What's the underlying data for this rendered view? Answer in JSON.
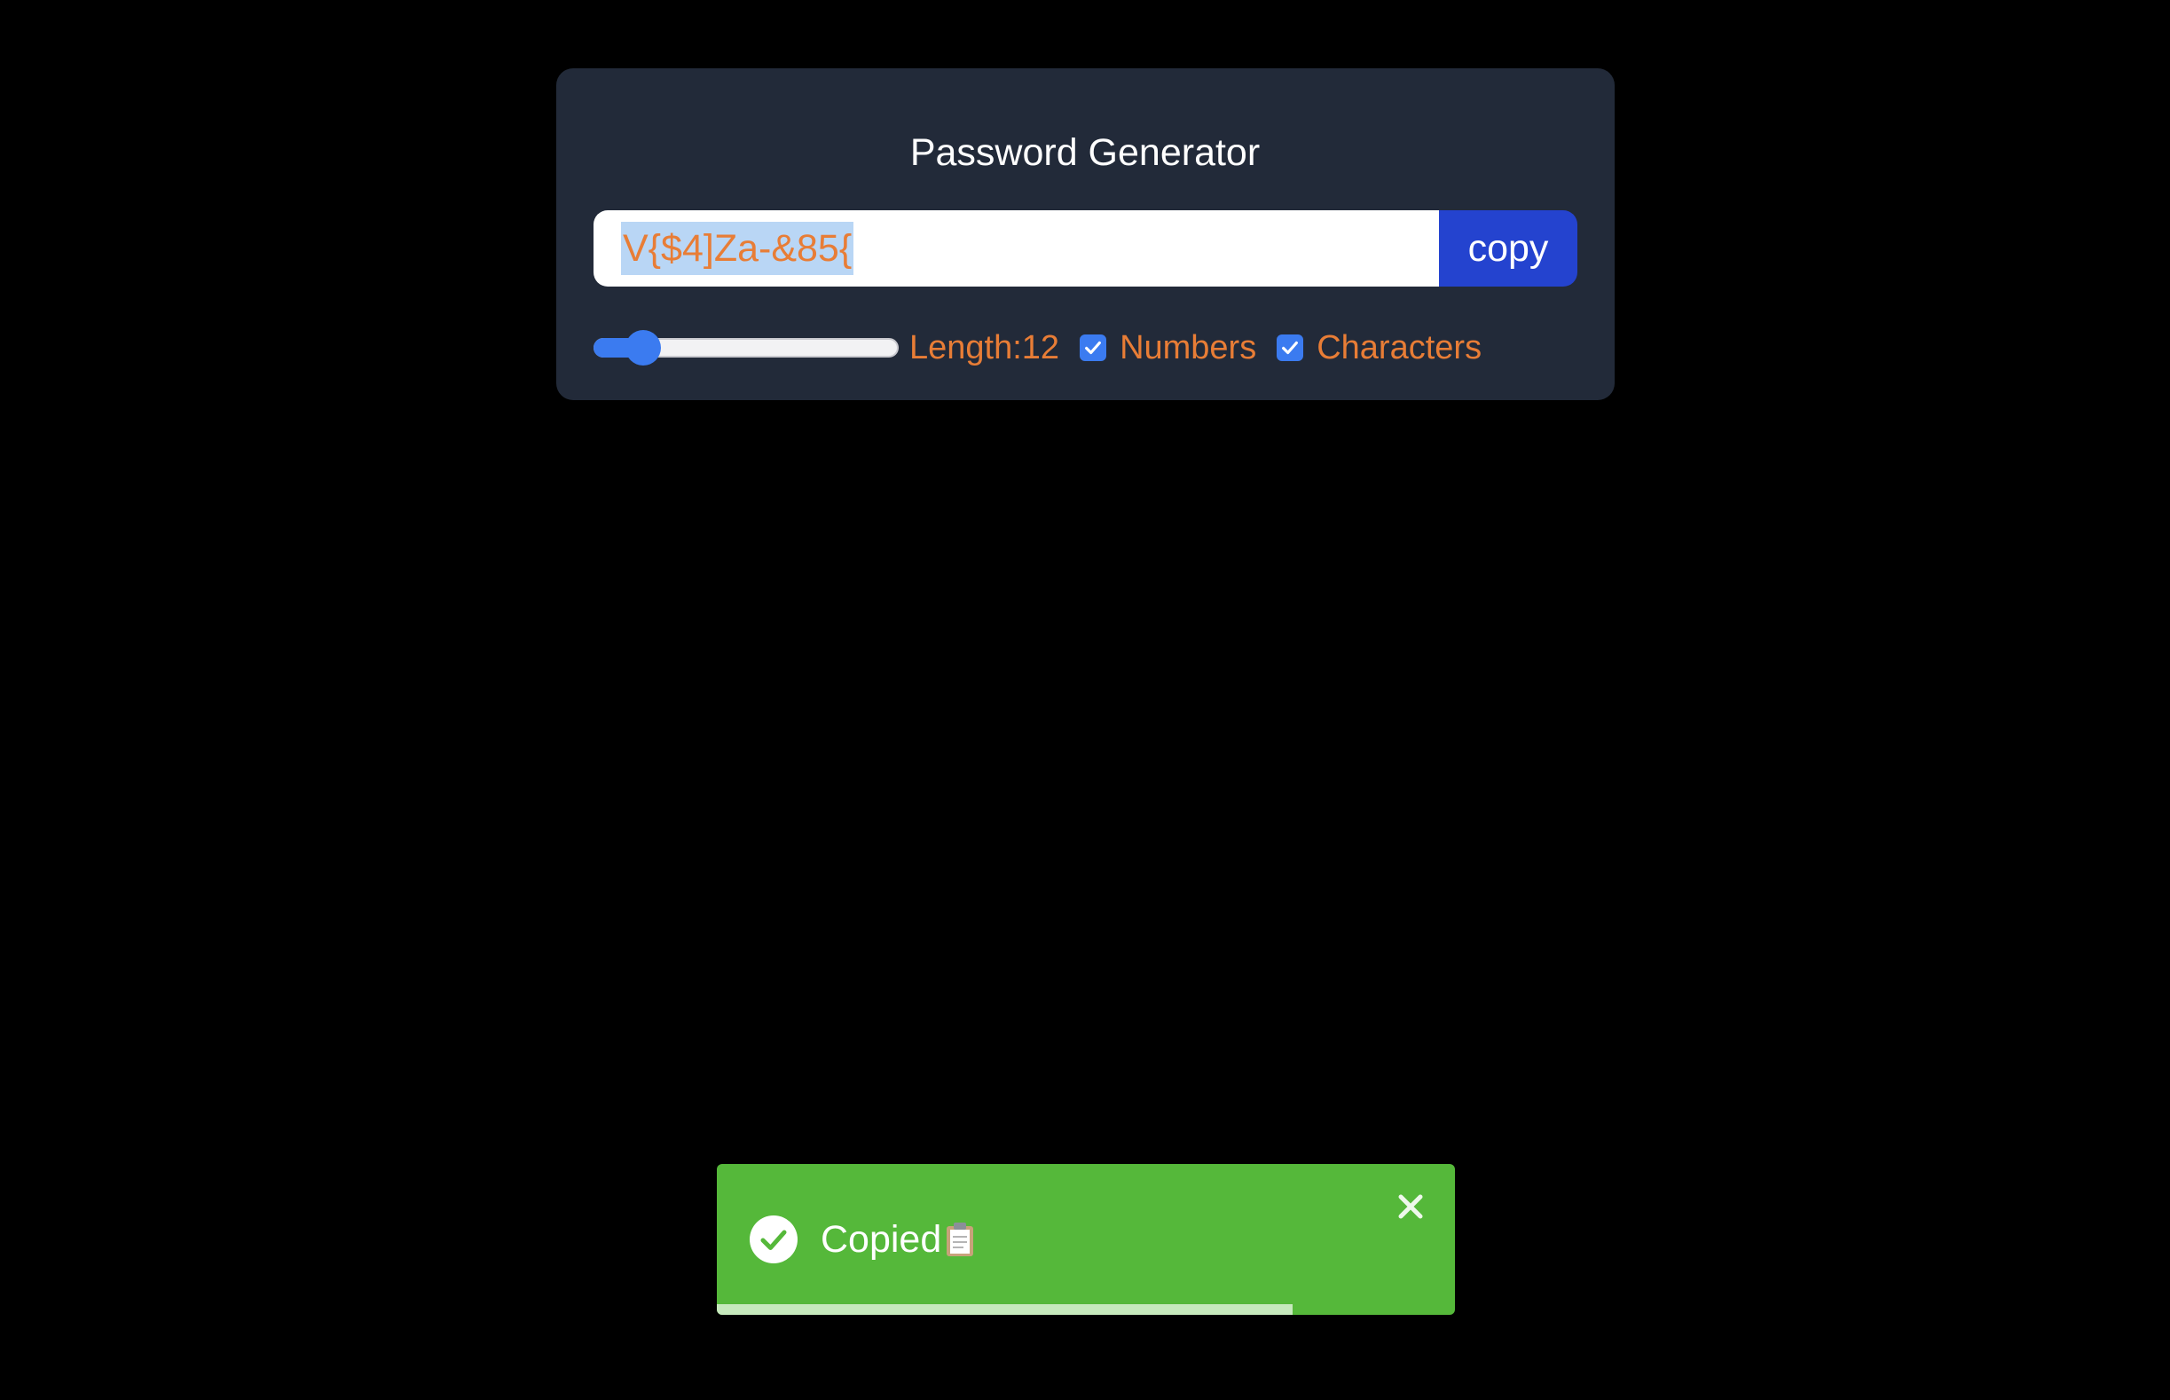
{
  "app": {
    "title": "Password Generator"
  },
  "password": {
    "value": "V{$4]Za-&85{"
  },
  "copy_button": {
    "label": "copy"
  },
  "length": {
    "label": "Length:12",
    "value": 12,
    "fraction": 0.12
  },
  "options": {
    "numbers": {
      "label": "Numbers",
      "checked": true
    },
    "characters": {
      "label": "Characters",
      "checked": true
    }
  },
  "toast": {
    "message": "Copied",
    "status": "success",
    "icons": [
      "check-circle-icon",
      "clipboard-icon",
      "close-icon"
    ],
    "progress": 0.78
  },
  "colors": {
    "background": "#000000",
    "card": "#222a39",
    "accent_text": "#e87d36",
    "copy_button": "#2443cf",
    "slider": "#3b7bf0",
    "toast": "#55b83a",
    "selection": "#b9d6f5"
  }
}
